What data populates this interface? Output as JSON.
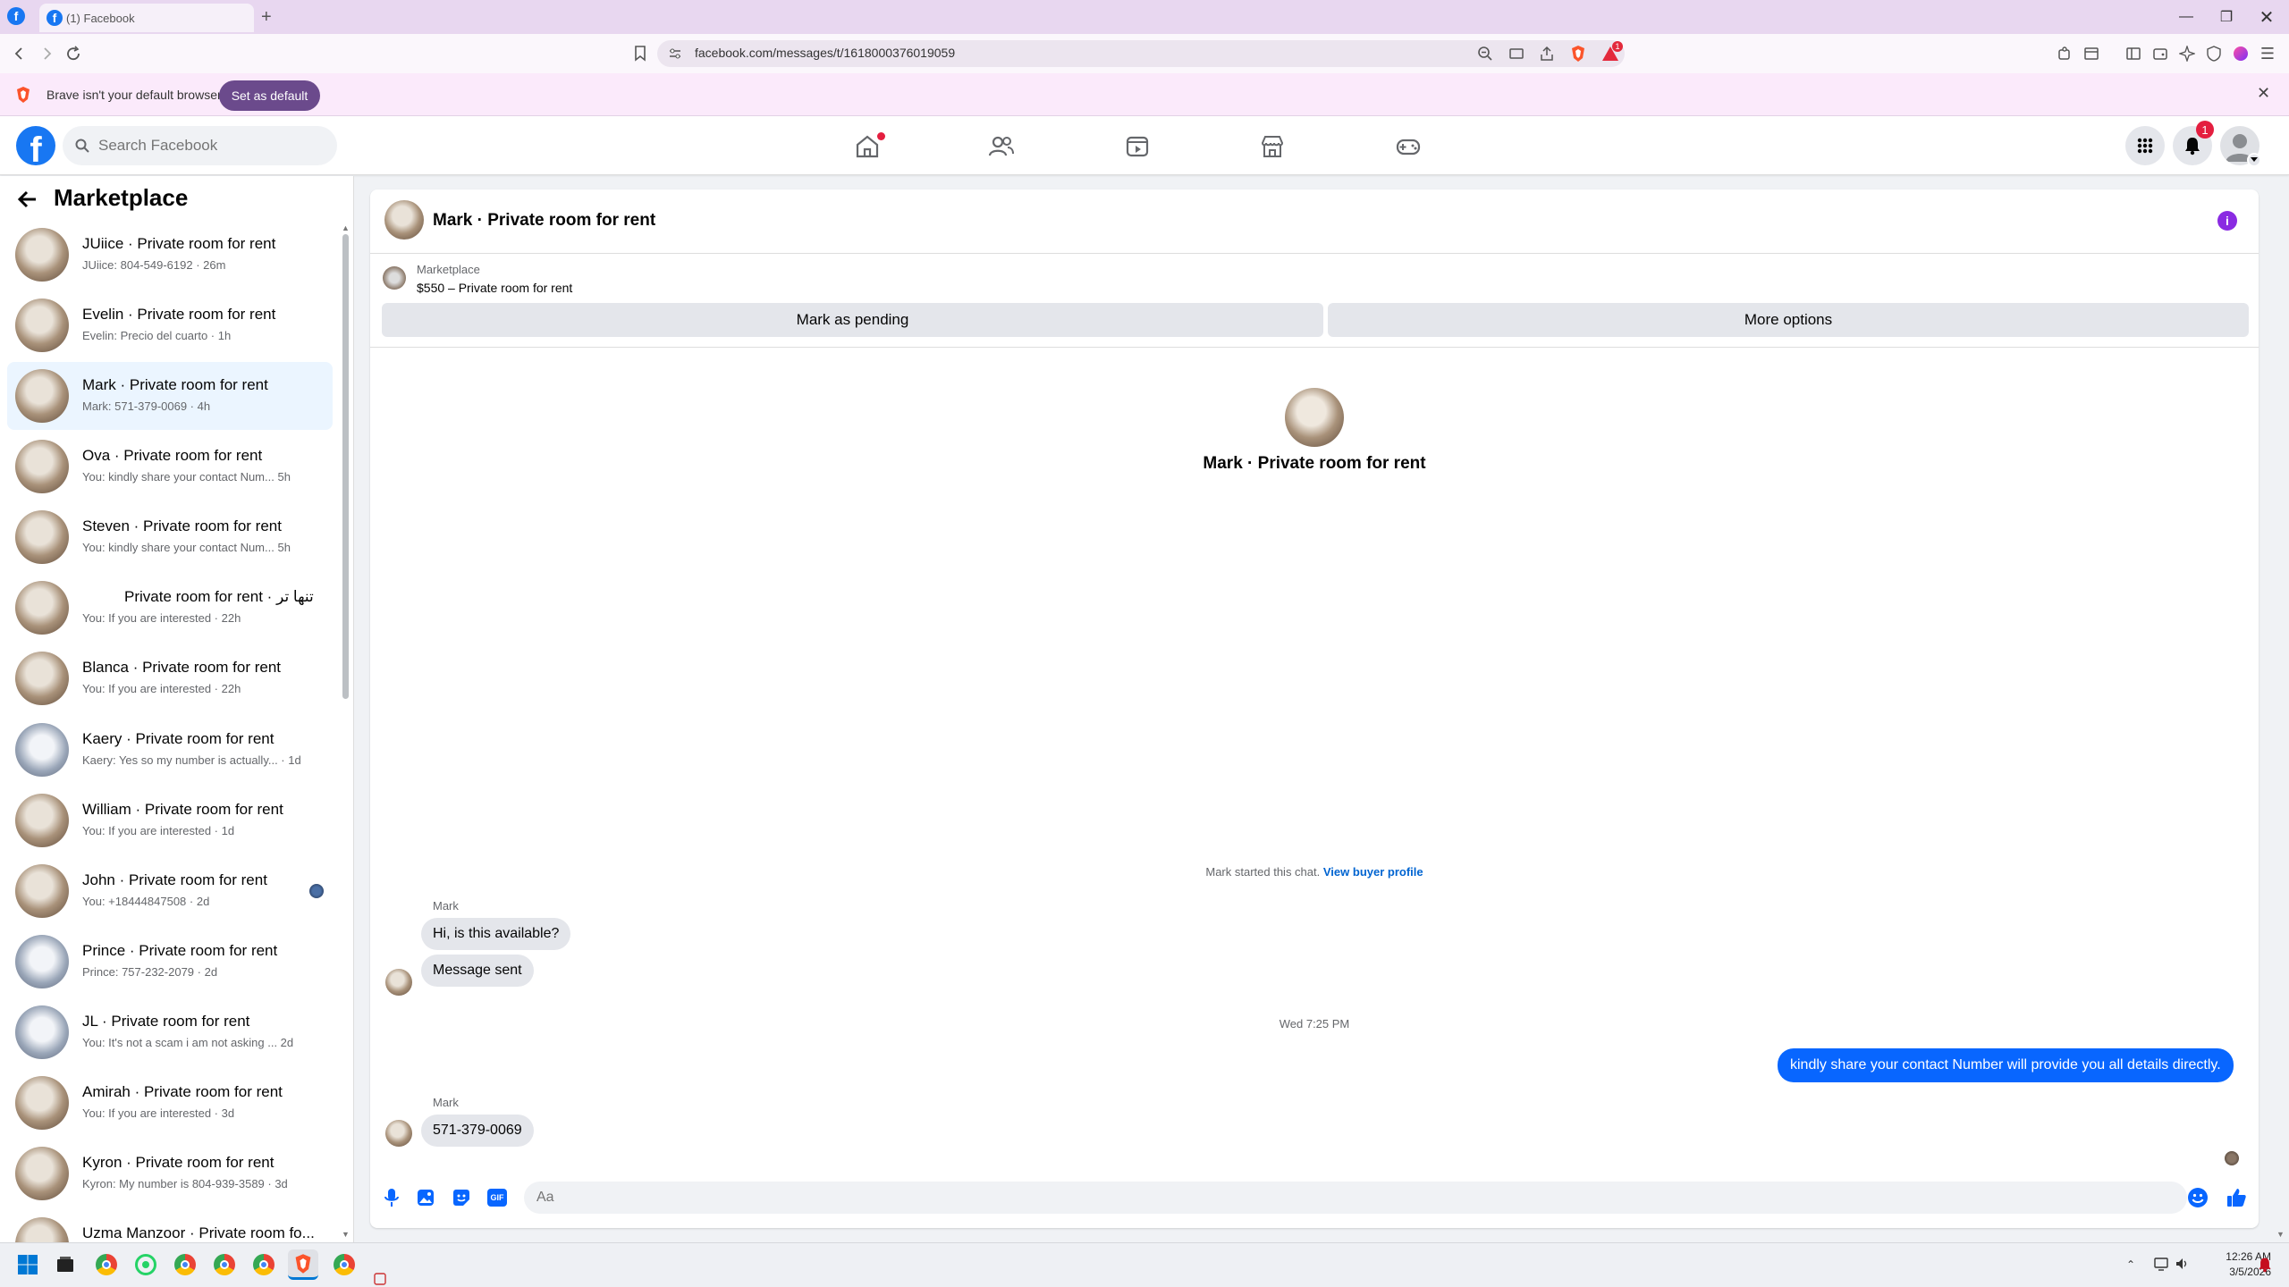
{
  "browser": {
    "tab_title": "(1) Facebook",
    "url": "facebook.com/messages/t/1618000376019059",
    "infobar_text": "Brave isn't your default browser",
    "set_default_label": "Set as default",
    "shields_badge": "1"
  },
  "facebook": {
    "search_placeholder": "Search Facebook",
    "notifications_count": "1",
    "brand_color": "#1877f2"
  },
  "sidebar": {
    "title": "Marketplace",
    "conversations": [
      {
        "title": "JUiice · Private room for rent",
        "subtitle": "JUiice: 804-549-6192 · 26m"
      },
      {
        "title": "Evelin · Private room for rent",
        "subtitle": "Evelin: Precio del cuarto · 1h"
      },
      {
        "title": "Mark · Private room for rent",
        "subtitle": "Mark: 571-379-0069 · 4h"
      },
      {
        "title": "Ova · Private room for rent",
        "subtitle": "You: kindly share your contact Num...  5h"
      },
      {
        "title": "Steven · Private room for rent",
        "subtitle": "You: kindly share your contact Num...  5h"
      },
      {
        "title": "Private room for rent · تنها تر",
        "subtitle": "You: If you are interested · 22h"
      },
      {
        "title": "Blanca · Private room for rent",
        "subtitle": "You: If you are interested · 22h"
      },
      {
        "title": "Kaery · Private room for rent",
        "subtitle": "Kaery: Yes so my number is actually... · 1d"
      },
      {
        "title": "William · Private room for rent",
        "subtitle": "You: If you are interested · 1d"
      },
      {
        "title": "John · Private room for rent",
        "subtitle": "You: +18444847508 · 2d"
      },
      {
        "title": "Prince · Private room for rent",
        "subtitle": "Prince: 757-232-2079 · 2d"
      },
      {
        "title": "JL · Private room for rent",
        "subtitle": "You: It's not a scam i am not asking ... 2d"
      },
      {
        "title": "Amirah · Private room for rent",
        "subtitle": "You: If you are interested · 3d"
      },
      {
        "title": "Kyron · Private room for rent",
        "subtitle": "Kyron: My number is 804-939-3589 · 3d"
      },
      {
        "title": "Uzma Manzoor · Private room fo...",
        "subtitle": ""
      }
    ]
  },
  "chat": {
    "title": "Mark · Private room for rent",
    "listing_source": "Marketplace",
    "listing_price": "$550 – Private room for rent",
    "mark_pending_label": "Mark as pending",
    "more_options_label": "More options",
    "profile_name": "Mark · Private room for rent",
    "started_text": "Mark started this chat.",
    "view_profile_label": "View buyer profile",
    "sender_name": "Mark",
    "msg1": "Hi, is this available?",
    "msg2": "Message sent",
    "timestamp": "Wed 7:25 PM",
    "msg_out": "kindly share your contact Number will provide you all details directly.",
    "sender_name2": "Mark",
    "msg3": "571-379-0069",
    "composer_placeholder": "Aa"
  },
  "taskbar": {
    "time": "12:26 AM",
    "date": "3/5/2026"
  }
}
